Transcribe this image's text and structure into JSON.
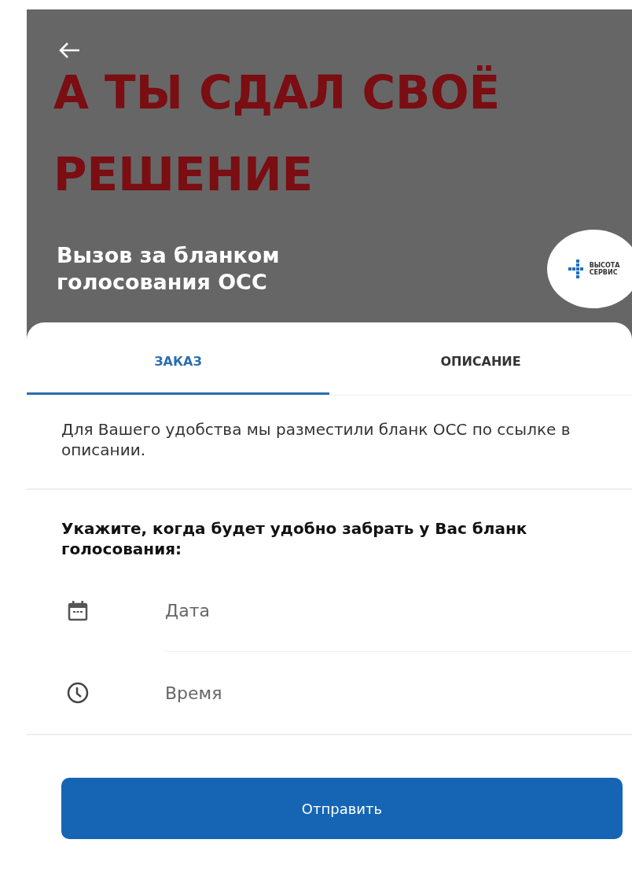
{
  "banner": {
    "lines": [
      "А ТЫ СДАЛ СВОЁ",
      "РЕШЕНИЕ"
    ]
  },
  "header": {
    "title_line_1": "Вызов за бланком",
    "title_line_2": "голосования ОСС",
    "logo_text": [
      "ВЫСОТА",
      "СЕРВИС"
    ]
  },
  "tabs": [
    {
      "label": "ЗАКАЗ",
      "selected": true
    },
    {
      "label": "ОПИСАНИЕ",
      "selected": false
    }
  ],
  "intro": "Для Вашего удобства мы разместили бланк ОСС по ссылке в описании.",
  "question": "Укажите, когда будет удобно забрать у Вас бланк голосования:",
  "fields": [
    {
      "kind": "date",
      "placeholder": "Дата"
    },
    {
      "kind": "time",
      "placeholder": "Время"
    }
  ],
  "submit": "Отправить"
}
